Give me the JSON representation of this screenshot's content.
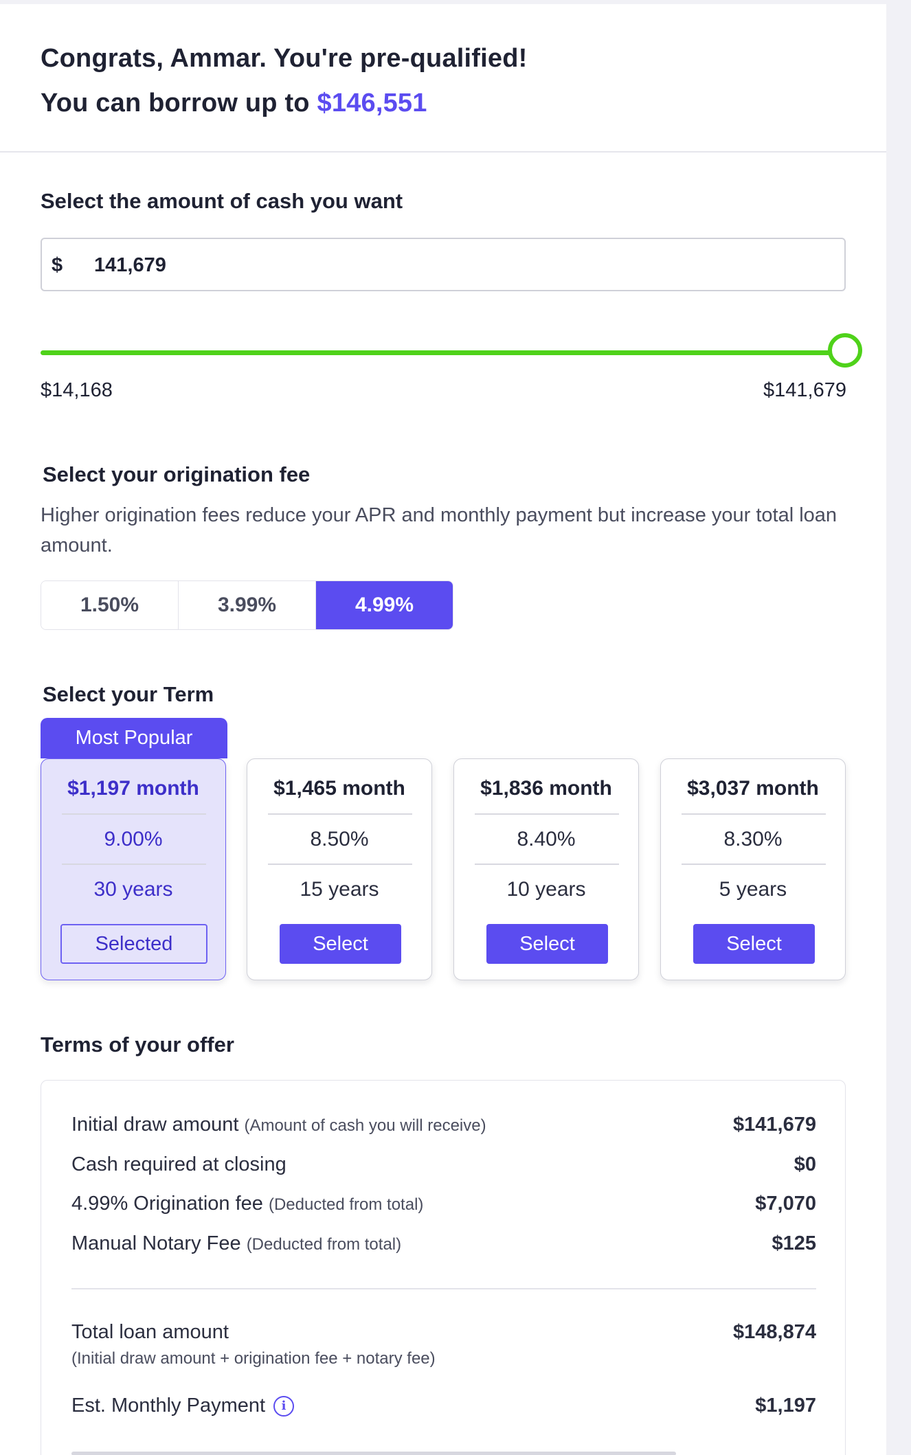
{
  "header": {
    "congrats_text": "Congrats, Ammar. You're pre-qualified!",
    "borrow_prefix": "You can borrow up to",
    "borrow_amount": "$146,551"
  },
  "cash": {
    "title": "Select the amount of cash you want",
    "currency_symbol": "$",
    "value": "141,679",
    "slider_min_label": "$14,168",
    "slider_max_label": "$141,679",
    "slider_level": 1.0
  },
  "origination": {
    "title": "Select your origination fee",
    "description": "Higher origination fees reduce your APR and monthly payment but increase your total loan amount.",
    "options": [
      "1.50%",
      "3.99%",
      "4.99%"
    ],
    "selected": "4.99%"
  },
  "term": {
    "title": "Select your Term",
    "badge": "Most Popular",
    "cards": [
      {
        "monthly": "$1,197 month",
        "rate": "9.00%",
        "years": "30 years",
        "button": "Selected",
        "selected": true
      },
      {
        "monthly": "$1,465 month",
        "rate": "8.50%",
        "years": "15 years",
        "button": "Select",
        "selected": false
      },
      {
        "monthly": "$1,836 month",
        "rate": "8.40%",
        "years": "10 years",
        "button": "Select",
        "selected": false
      },
      {
        "monthly": "$3,037 month",
        "rate": "8.30%",
        "years": "5 years",
        "button": "Select",
        "selected": false
      }
    ]
  },
  "offer": {
    "title": "Terms of your offer",
    "rows": [
      {
        "label": "Initial draw amount",
        "note": "(Amount of cash you will receive)",
        "value": "$141,679"
      },
      {
        "label": "Cash required at closing",
        "note": "",
        "value": "$0"
      },
      {
        "label": "4.99% Origination fee",
        "note": "(Deducted from total)",
        "value": "$7,070"
      },
      {
        "label": "Manual Notary Fee",
        "note": "(Deducted from total)",
        "value": "$125"
      }
    ],
    "total_label": "Total loan amount",
    "total_sub": "(Initial draw amount + origination fee + notary fee)",
    "total_value": "$148,874",
    "monthly_label": "Est. Monthly Payment",
    "monthly_value": "$1,197"
  },
  "colors": {
    "accent": "#5b4cf0",
    "slider": "#4fd21a",
    "selected_card_bg": "#e5e3fb"
  },
  "icons": {
    "info": "info-circle-icon"
  }
}
